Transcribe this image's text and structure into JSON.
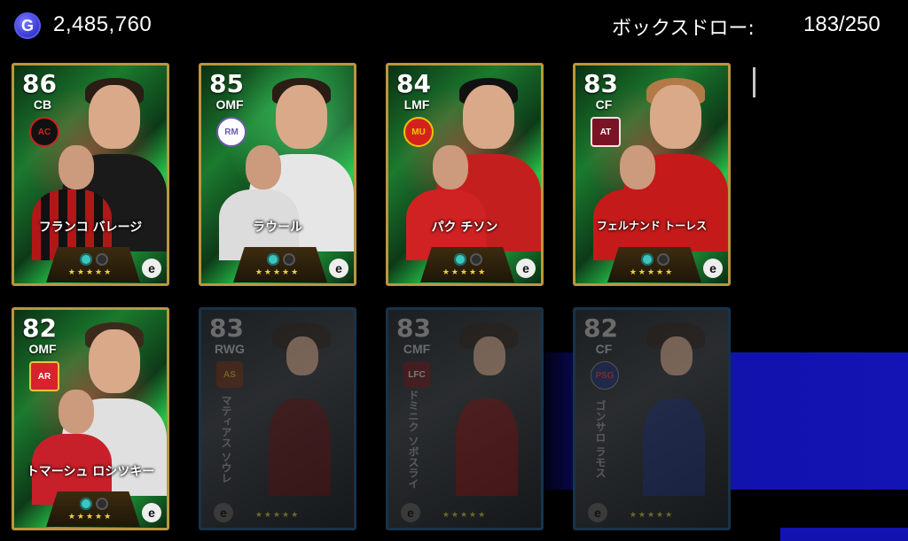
{
  "header": {
    "coin_icon": "G",
    "coin_amount": "2,485,760",
    "box_draw_label": "ボックスドロー:",
    "box_draw_count": "183/250"
  },
  "cards": [
    {
      "rating": "86",
      "position": "CB",
      "name": "フランコ バレージ",
      "club_icon": "milan-crest-icon",
      "state": "active"
    },
    {
      "rating": "85",
      "position": "OMF",
      "name": "ラウール",
      "club_icon": "real-madrid-crest-icon",
      "state": "active"
    },
    {
      "rating": "84",
      "position": "LMF",
      "name": "パク チソン",
      "club_icon": "man-united-crest-icon",
      "state": "active"
    },
    {
      "rating": "83",
      "position": "CF",
      "name": "フェルナンド トーレス",
      "club_icon": "atletico-crest-icon",
      "state": "active"
    },
    {
      "rating": "82",
      "position": "OMF",
      "name": "トマーシュ ロシツキー",
      "club_icon": "arsenal-crest-icon",
      "state": "active"
    },
    {
      "rating": "83",
      "position": "RWG",
      "name": "マティアス ソウレ",
      "club_icon": "roma-crest-icon",
      "state": "locked"
    },
    {
      "rating": "83",
      "position": "CMF",
      "name": "ドミニク ソボスライ",
      "club_icon": "liverpool-crest-icon",
      "state": "locked"
    },
    {
      "rating": "82",
      "position": "CF",
      "name": "ゴンサロ ラモス",
      "club_icon": "psg-crest-icon",
      "state": "locked"
    }
  ],
  "stars": "★★★★★",
  "efootball_icon": "e"
}
